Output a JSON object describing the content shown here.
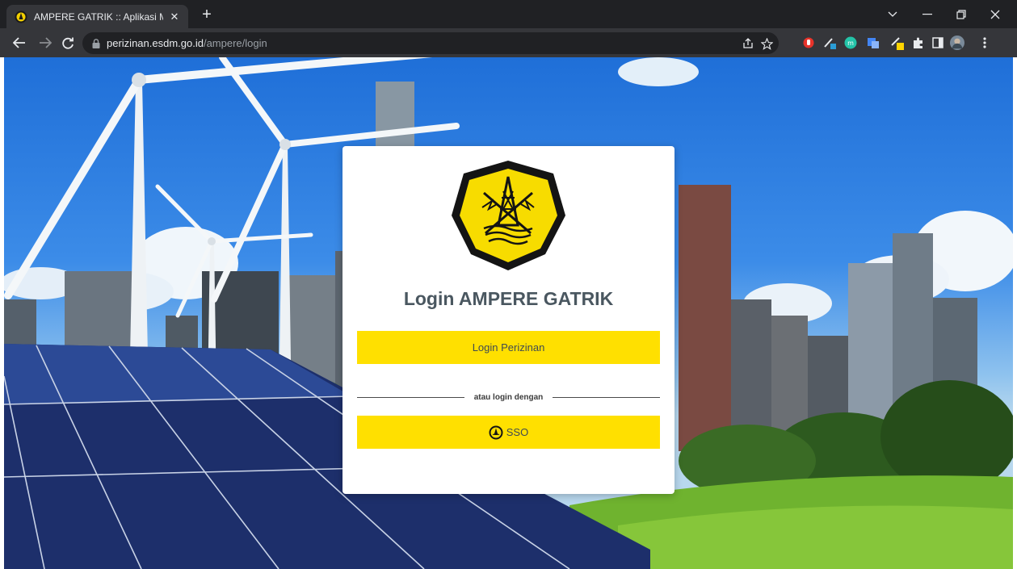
{
  "browser": {
    "tab_title": "AMPERE GATRIK :: Aplikasi Mana",
    "tab_close": "✕",
    "new_tab": "+",
    "url_host": "perizinan.esdm.go.id",
    "url_path": "/ampere/login"
  },
  "login": {
    "title": "Login AMPERE GATRIK",
    "perizinan_label": "Login Perizinan",
    "divider_text": "atau login dengan",
    "sso_label": "SSO"
  },
  "colors": {
    "accent": "#ffe000",
    "title": "#4a5760"
  }
}
